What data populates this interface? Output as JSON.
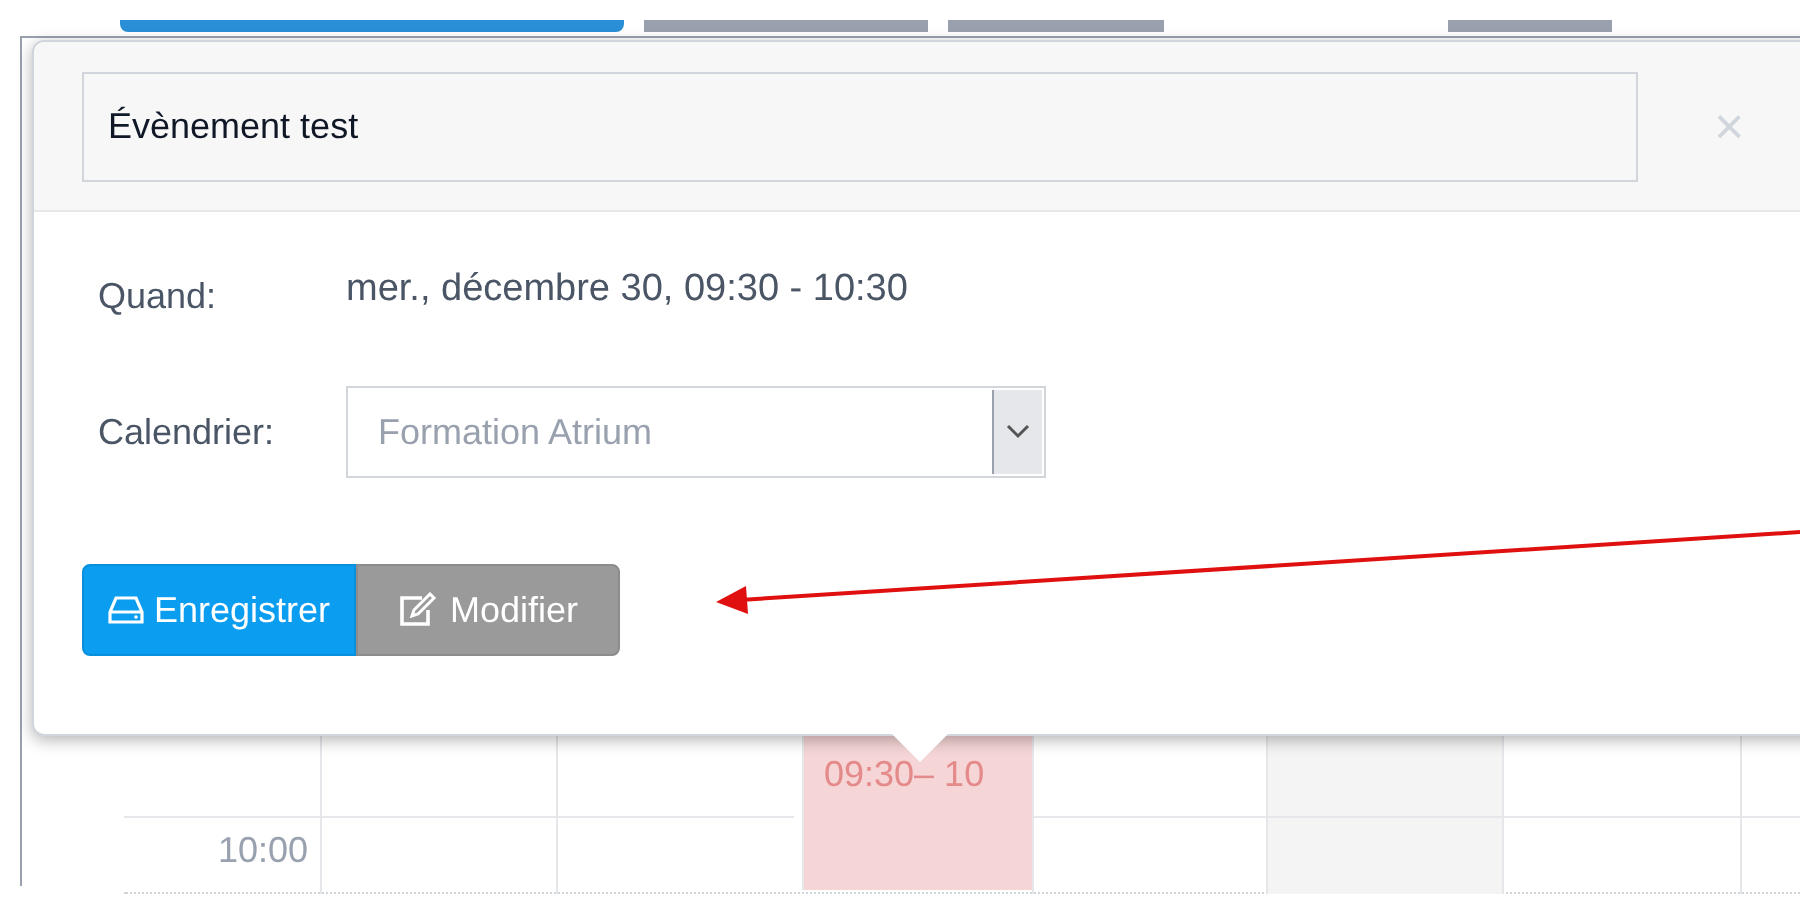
{
  "event_popup": {
    "title_value": "Évènement test",
    "close": "×",
    "fields": [
      {
        "label": "Quand:",
        "kind": "text",
        "value": "mer., décembre 30, 09:30 - 10:30"
      },
      {
        "label": "Calendrier:",
        "kind": "select",
        "value": "Formation Atrium"
      }
    ],
    "buttons": [
      {
        "label": "Enregistrer",
        "kind": "primary"
      },
      {
        "label": "Modifier",
        "kind": "secondary"
      }
    ]
  },
  "calendar": {
    "time_label": "10:00",
    "event": {
      "time": "09:30– 10"
    }
  }
}
